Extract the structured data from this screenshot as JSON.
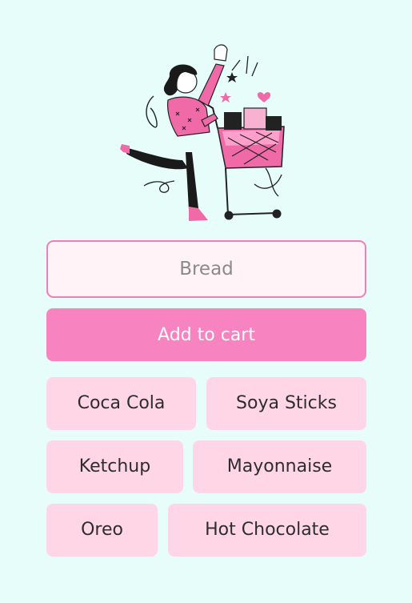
{
  "hero": {
    "image_name": "shopping-woman-with-cart-illustration"
  },
  "input": {
    "placeholder": "Bread",
    "value": ""
  },
  "add_button": {
    "label": "Add to cart"
  },
  "items": [
    {
      "label": "Coca Cola"
    },
    {
      "label": "Soya Sticks"
    },
    {
      "label": "Ketchup"
    },
    {
      "label": "Mayonnaise"
    },
    {
      "label": "Oreo"
    },
    {
      "label": "Hot Chocolate"
    }
  ],
  "colors": {
    "background": "#e6fdf9",
    "accent": "#f783c0",
    "input_border": "#f07fb8",
    "input_bg": "#fff3f7",
    "chip_bg": "#ffd6e6",
    "chip_text": "#2d2d2d"
  }
}
